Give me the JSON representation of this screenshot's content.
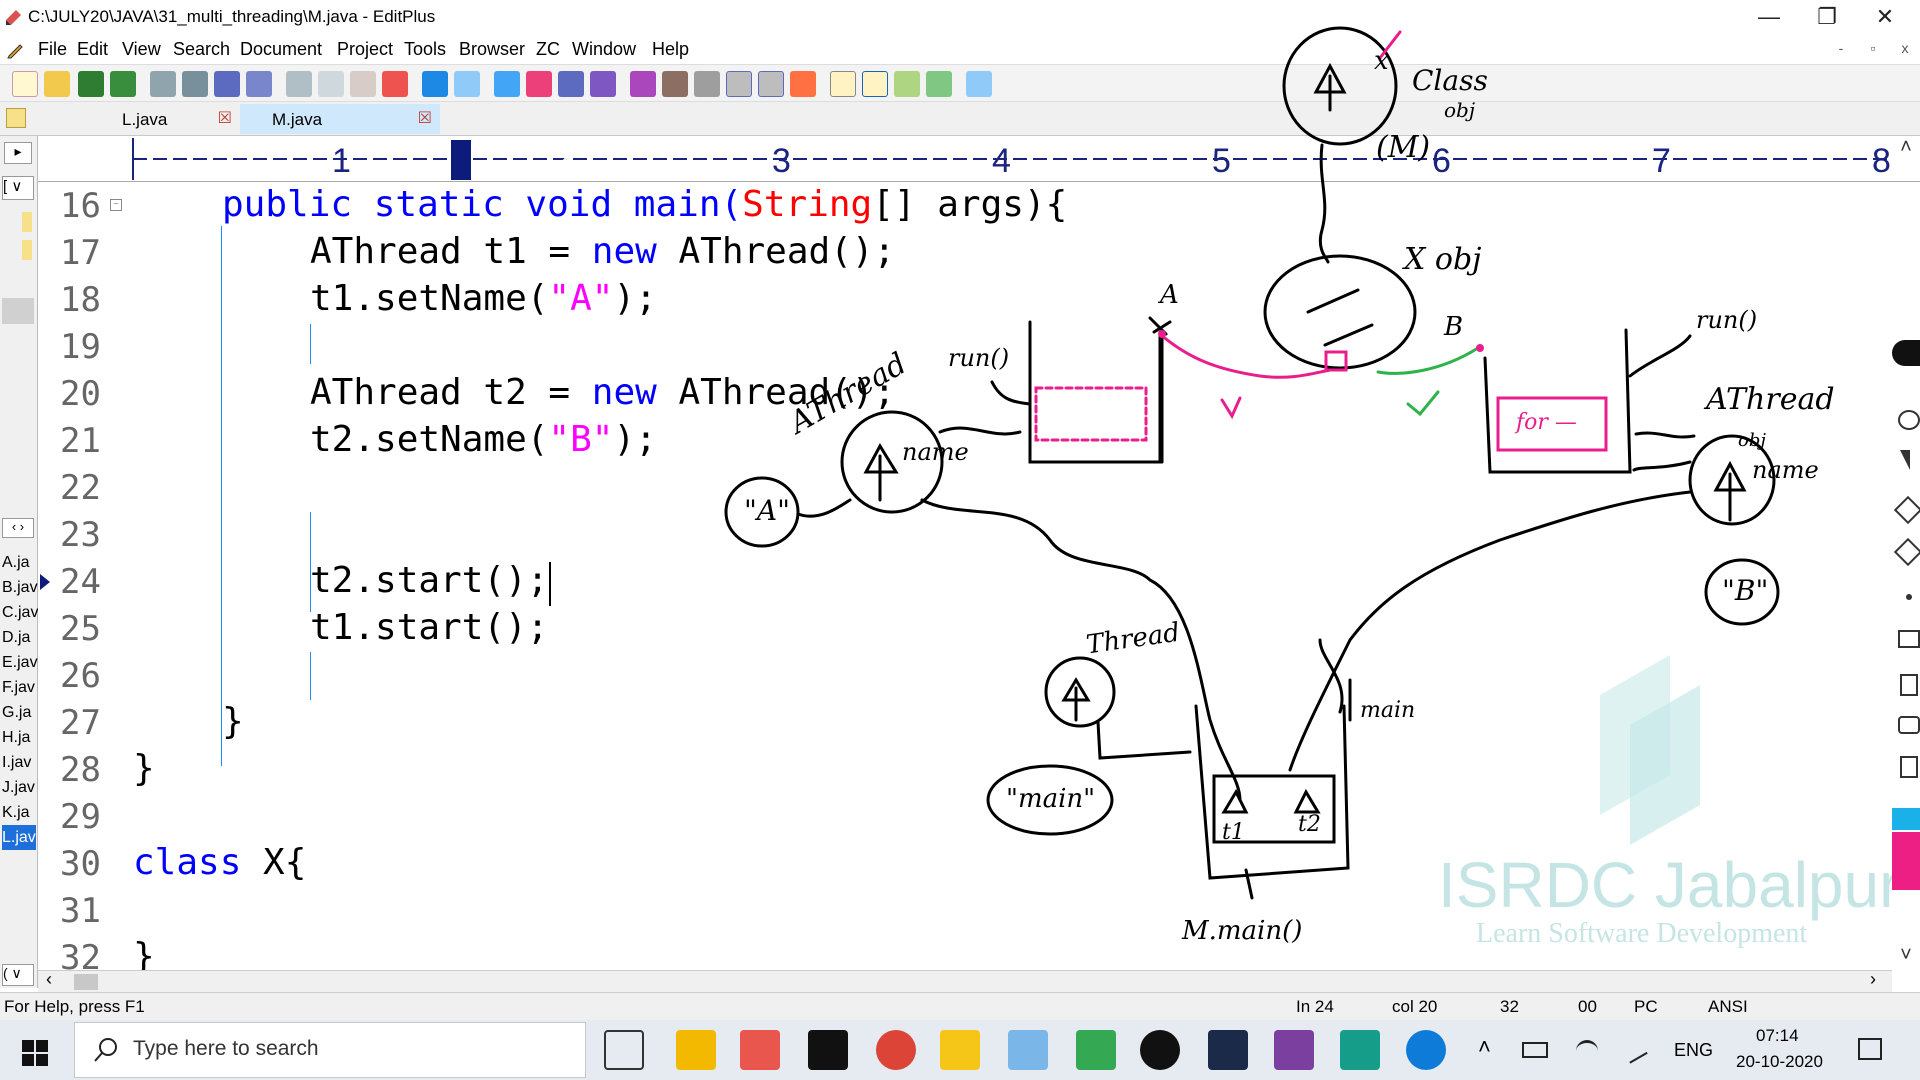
{
  "window": {
    "title": "C:\\JULY20\\JAVA\\31_multi_threading\\M.java - EditPlus",
    "minimize": "—",
    "restore": "❐",
    "close": "✕"
  },
  "menu": [
    "File",
    "Edit",
    "View",
    "Search",
    "Document",
    "Project",
    "Tools",
    "Browser",
    "ZC",
    "Window",
    "Help"
  ],
  "mdi_controls": [
    "-",
    "▫",
    "x"
  ],
  "tabs": [
    {
      "label": "L.java",
      "close": "☒"
    },
    {
      "label": "M.java",
      "close": "☒"
    }
  ],
  "ruler": {
    "marks": [
      "1",
      "2",
      "3",
      "4",
      "5",
      "6",
      "7",
      "8"
    ],
    "active": "2"
  },
  "left_pane": {
    "arrows": [
      "‹ ›"
    ],
    "dropdown": "[ ∨",
    "files": [
      "A.ja",
      "B.jav",
      "C.jav",
      "D.ja",
      "E.jav",
      "F.jav",
      "G.ja",
      "H.ja",
      "I.jav",
      "J.jav",
      "K.ja",
      "L.jav"
    ],
    "bottom_dropdown": "( ∨"
  },
  "editor": {
    "line_numbers": [
      "16",
      "17",
      "18",
      "19",
      "20",
      "21",
      "22",
      "23",
      "24",
      "25",
      "26",
      "27",
      "28",
      "29",
      "30",
      "31",
      "32"
    ],
    "lines": {
      "l16a": "public static void main(",
      "l16b": "String",
      "l16c": "[] args){",
      "l17a": "AThread t1 = ",
      "l17b": "new",
      "l17c": " AThread();",
      "l18a": "t1.setName(",
      "l18b": "\"A\"",
      "l18c": ");",
      "l20a": "AThread t2 = ",
      "l20b": "new",
      "l20c": " AThread();",
      "l21a": "t2.setName(",
      "l21b": "\"B\"",
      "l21c": ");",
      "l24": "t2.start();",
      "l25": "t1.start();",
      "l27": "}",
      "l28": "}",
      "l30a": "class",
      "l30b": " X{",
      "l32": "}"
    }
  },
  "annotations": {
    "class_label": "Class",
    "class_obj": "obj",
    "m_label": "(M)",
    "x_obj": "X obj",
    "label_a": "A",
    "label_b": "B",
    "run_left": "run()",
    "run_right": "run()",
    "athread_left": "AThread",
    "athread_right": "AThread",
    "obj_small": "obj",
    "name_left": "name",
    "name_right": "name",
    "str_a": "\"A\"",
    "str_b": "\"B\"",
    "for_text": "for —",
    "thread_label": "Thread",
    "main_circle": "\"main\"",
    "main_stack": "main",
    "t1": "t1",
    "t2": "t2",
    "m_main": "M.main()",
    "x_mark": "x"
  },
  "watermark": {
    "title": "ISRDC Jabalpur",
    "subtitle": "Learn Software Development"
  },
  "status": {
    "help": "For Help, press F1",
    "ln": "In 24",
    "col": "col 20",
    "n32": "32",
    "n00": "00",
    "pc": "PC",
    "enc": "ANSI"
  },
  "taskbar": {
    "search_placeholder": "Type here to search",
    "lang": "ENG",
    "time": "07:14",
    "date": "20-10-2020"
  }
}
